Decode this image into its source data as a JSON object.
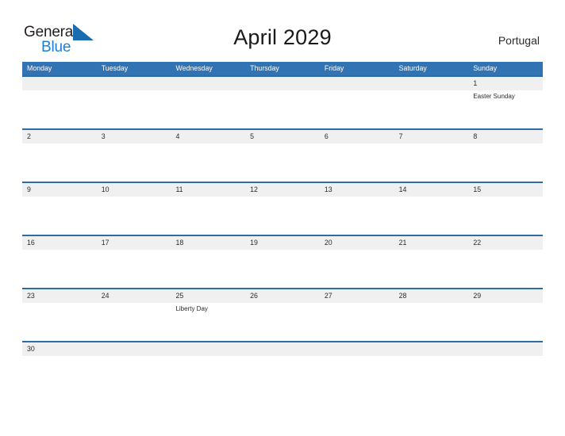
{
  "brand": {
    "name_part1": "General",
    "name_part2": "Blue",
    "flag_icon": "blue-flag-triangle",
    "color_dark": "#231f20",
    "color_blue": "#1b7fd4"
  },
  "header": {
    "title": "April 2029",
    "region": "Portugal"
  },
  "theme": {
    "header_blue": "#3273b3",
    "row_rule_blue": "#2e6da4",
    "date_band_gray": "#f0f0f0",
    "page_background": "#ffffff"
  },
  "calendar": {
    "month": "April",
    "year": "2029",
    "weekday_headers": [
      "Monday",
      "Tuesday",
      "Wednesday",
      "Thursday",
      "Friday",
      "Saturday",
      "Sunday"
    ],
    "weeks": [
      {
        "days": [
          {
            "num": "",
            "event": ""
          },
          {
            "num": "",
            "event": ""
          },
          {
            "num": "",
            "event": ""
          },
          {
            "num": "",
            "event": ""
          },
          {
            "num": "",
            "event": ""
          },
          {
            "num": "",
            "event": ""
          },
          {
            "num": "1",
            "event": "Easter Sunday"
          }
        ]
      },
      {
        "days": [
          {
            "num": "2",
            "event": ""
          },
          {
            "num": "3",
            "event": ""
          },
          {
            "num": "4",
            "event": ""
          },
          {
            "num": "5",
            "event": ""
          },
          {
            "num": "6",
            "event": ""
          },
          {
            "num": "7",
            "event": ""
          },
          {
            "num": "8",
            "event": ""
          }
        ]
      },
      {
        "days": [
          {
            "num": "9",
            "event": ""
          },
          {
            "num": "10",
            "event": ""
          },
          {
            "num": "11",
            "event": ""
          },
          {
            "num": "12",
            "event": ""
          },
          {
            "num": "13",
            "event": ""
          },
          {
            "num": "14",
            "event": ""
          },
          {
            "num": "15",
            "event": ""
          }
        ]
      },
      {
        "days": [
          {
            "num": "16",
            "event": ""
          },
          {
            "num": "17",
            "event": ""
          },
          {
            "num": "18",
            "event": ""
          },
          {
            "num": "19",
            "event": ""
          },
          {
            "num": "20",
            "event": ""
          },
          {
            "num": "21",
            "event": ""
          },
          {
            "num": "22",
            "event": ""
          }
        ]
      },
      {
        "days": [
          {
            "num": "23",
            "event": ""
          },
          {
            "num": "24",
            "event": ""
          },
          {
            "num": "25",
            "event": "Liberty Day"
          },
          {
            "num": "26",
            "event": ""
          },
          {
            "num": "27",
            "event": ""
          },
          {
            "num": "28",
            "event": ""
          },
          {
            "num": "29",
            "event": ""
          }
        ]
      },
      {
        "days": [
          {
            "num": "30",
            "event": ""
          },
          {
            "num": "",
            "event": ""
          },
          {
            "num": "",
            "event": ""
          },
          {
            "num": "",
            "event": ""
          },
          {
            "num": "",
            "event": ""
          },
          {
            "num": "",
            "event": ""
          },
          {
            "num": "",
            "event": ""
          }
        ]
      }
    ]
  }
}
